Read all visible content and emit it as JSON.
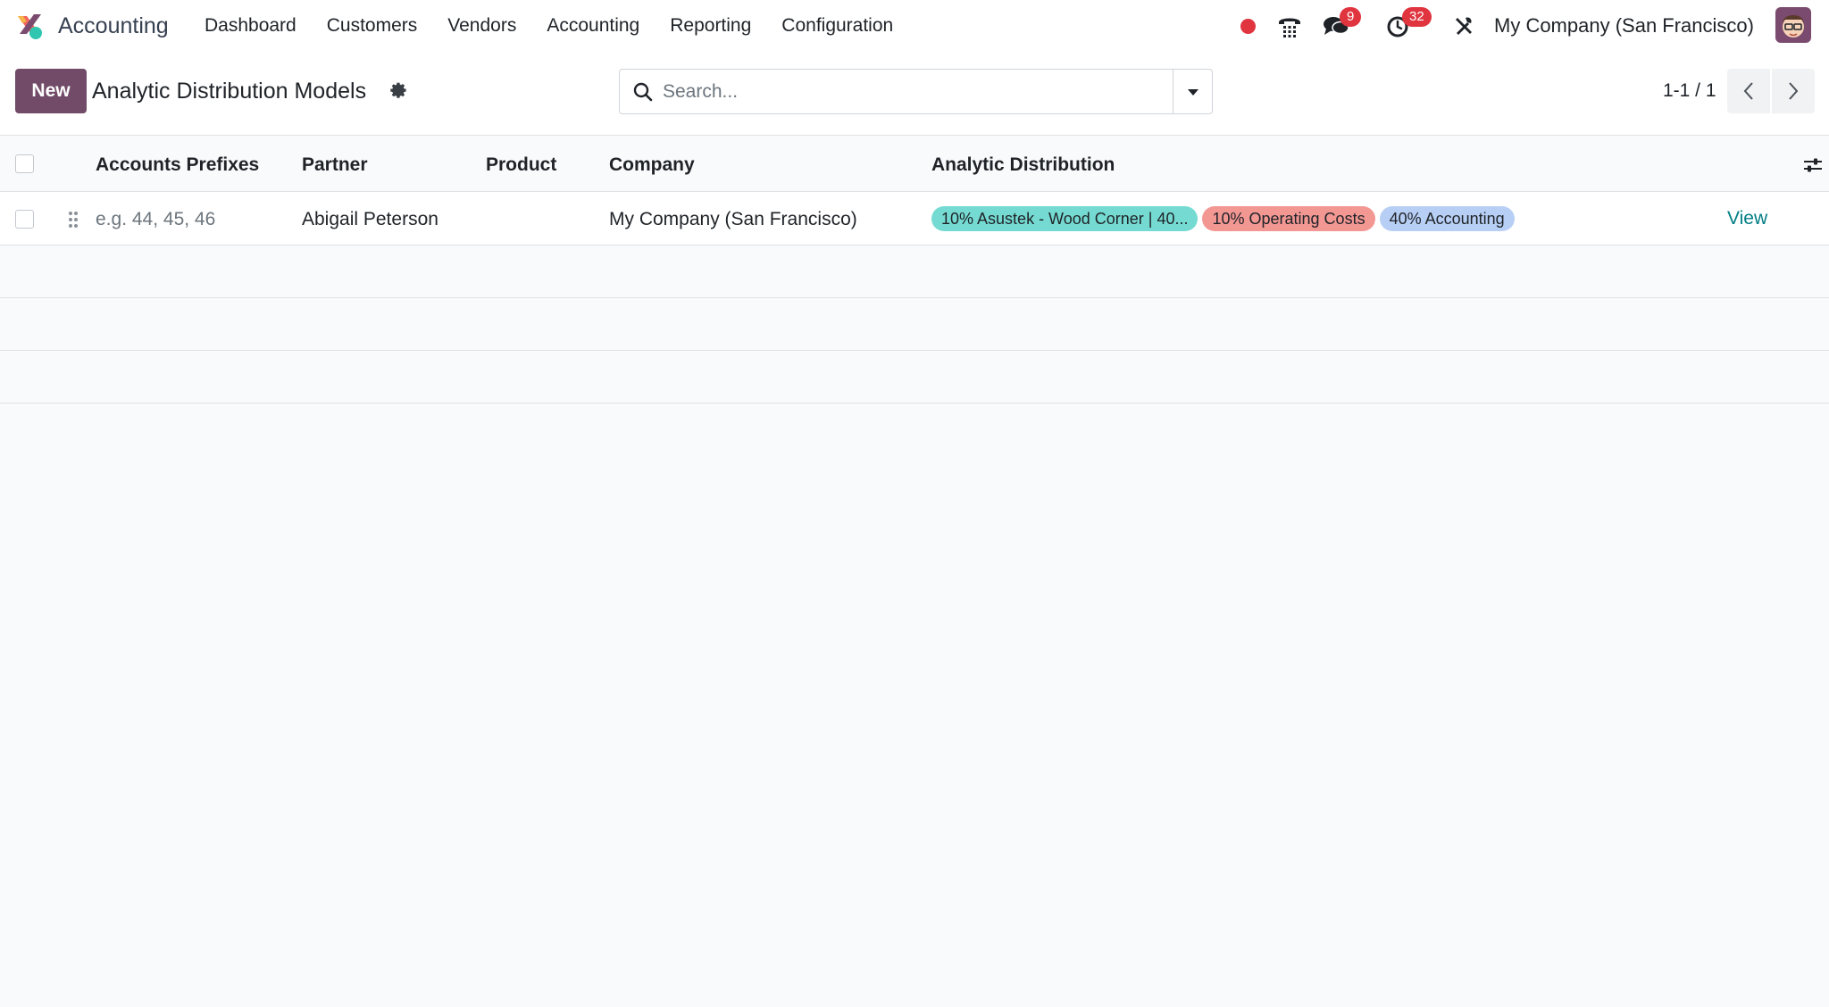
{
  "navbar": {
    "app_name": "Accounting",
    "menu": [
      "Dashboard",
      "Customers",
      "Vendors",
      "Accounting",
      "Reporting",
      "Configuration"
    ],
    "messages_badge": "9",
    "activities_badge": "32",
    "company": "My Company (San Francisco)"
  },
  "control_panel": {
    "new_label": "New",
    "title": "Analytic Distribution Models",
    "search_placeholder": "Search...",
    "pager": "1-1 / 1"
  },
  "list": {
    "columns": [
      "Accounts Prefixes",
      "Partner",
      "Product",
      "Company",
      "Analytic Distribution"
    ],
    "rows": [
      {
        "accounts_prefixes_placeholder": "e.g. 44, 45, 46",
        "partner": "Abigail Peterson",
        "product": "",
        "company": "My Company (San Francisco)",
        "distribution": [
          {
            "label": "10% Asustek - Wood Corner | 40...",
            "color": "#75dbd2"
          },
          {
            "label": "10% Operating Costs",
            "color": "#f39793"
          },
          {
            "label": "40% Accounting",
            "color": "#b8cff5"
          }
        ],
        "action": "View"
      }
    ]
  },
  "colors": {
    "brand": "#714b67",
    "badge": "#e0343f",
    "link": "#017e84"
  }
}
